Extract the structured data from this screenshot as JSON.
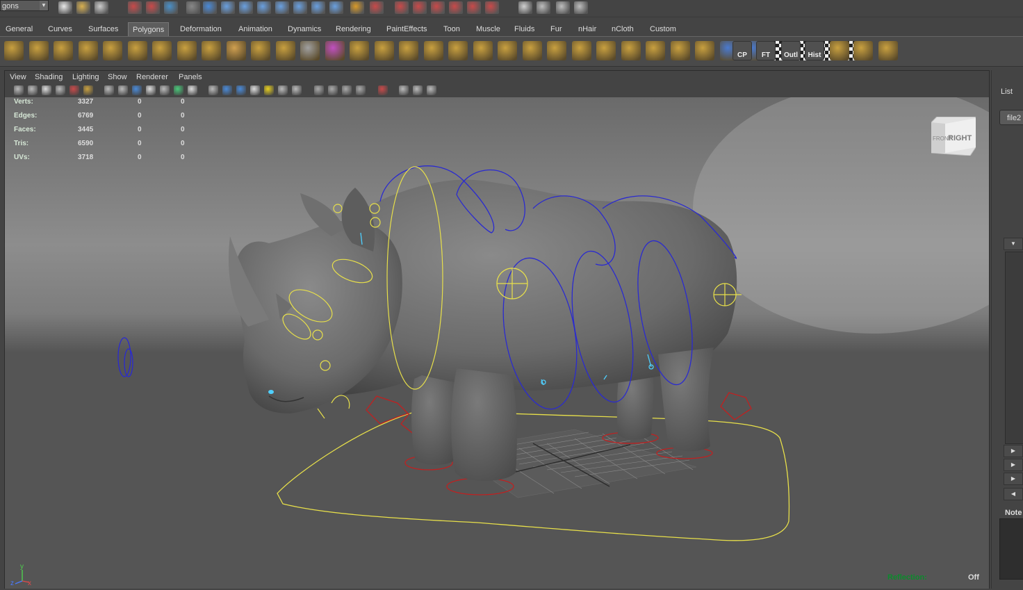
{
  "status_line": {
    "mode_selector": "gons"
  },
  "shelf_tabs": [
    {
      "label": "General"
    },
    {
      "label": "Curves"
    },
    {
      "label": "Surfaces"
    },
    {
      "label": "Polygons",
      "active": true
    },
    {
      "label": "Deformation"
    },
    {
      "label": "Animation"
    },
    {
      "label": "Dynamics"
    },
    {
      "label": "Rendering"
    },
    {
      "label": "PaintEffects"
    },
    {
      "label": "Toon"
    },
    {
      "label": "Muscle"
    },
    {
      "label": "Fluids"
    },
    {
      "label": "Fur"
    },
    {
      "label": "nHair"
    },
    {
      "label": "nCloth"
    },
    {
      "label": "Custom"
    }
  ],
  "shelf_text_icons": {
    "cp": "CP",
    "ft": "FT",
    "outl": "Outl",
    "hist": "Hist"
  },
  "panel_menu": [
    "View",
    "Shading",
    "Lighting",
    "Show",
    "Renderer",
    "Panels"
  ],
  "hud": {
    "rows": [
      {
        "label": "Verts:",
        "values": [
          "3327",
          "0",
          "0"
        ]
      },
      {
        "label": "Edges:",
        "values": [
          "6769",
          "0",
          "0"
        ]
      },
      {
        "label": "Faces:",
        "values": [
          "3445",
          "0",
          "0"
        ]
      },
      {
        "label": "Tris:",
        "values": [
          "6590",
          "0",
          "0"
        ]
      },
      {
        "label": "UVs:",
        "values": [
          "3718",
          "0",
          "0"
        ]
      }
    ]
  },
  "viewcube": {
    "front": "FRONT",
    "right": "RIGHT"
  },
  "axis": {
    "y": "y",
    "z": "z",
    "x": "x"
  },
  "reflection": {
    "label": "Reflection:",
    "value": "Off"
  },
  "right_dock": {
    "list_label": "List",
    "file_tab": "file2",
    "notes_label": "Note"
  },
  "colors": {
    "control_yellow": "#e8e04a",
    "control_blue": "#2a2ad0",
    "control_red": "#c02020",
    "control_cyan": "#4fd0ff",
    "hud_label_green": "#d7e8d7",
    "reflection_green": "#0c8a2c"
  }
}
